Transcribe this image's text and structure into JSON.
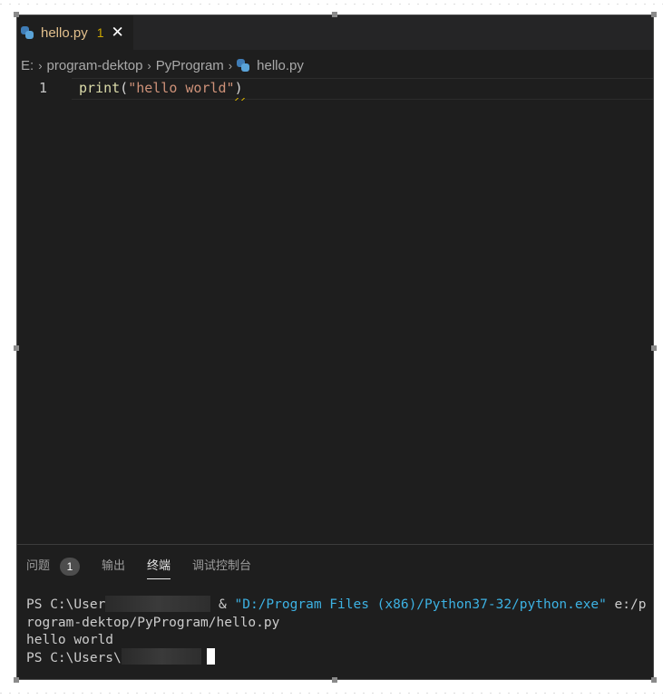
{
  "tab": {
    "title": "hello.py",
    "problems_badge": "1",
    "close_glyph": "✕",
    "icon": "python-file-icon"
  },
  "breadcrumb": {
    "items": [
      "E:",
      "program-dektop",
      "PyProgram",
      "hello.py"
    ],
    "separator": "›"
  },
  "editor": {
    "lines": [
      {
        "number": "1",
        "tokens": {
          "fn": "print",
          "open": "(",
          "str": "\"hello world\"",
          "close": ")"
        }
      }
    ]
  },
  "panel": {
    "tabs": [
      {
        "label": "问题",
        "badge": "1"
      },
      {
        "label": "输出"
      },
      {
        "label": "终端",
        "active": true
      },
      {
        "label": "调试控制台"
      }
    ]
  },
  "terminal": {
    "line1_prompt": "PS C:\\User",
    "line1_amp": "& ",
    "line1_exe": "\"D:/Program Files (x86)/Python37-32/python.exe\"",
    "line1_arg": " e:/p",
    "line2": "rogram-dektop/PyProgram/hello.py",
    "line3": "hello world",
    "line4_prompt": "PS C:\\Users\\"
  },
  "colors": {
    "editor_bg": "#1e1e1e",
    "tab_modified": "#e2c08d",
    "warning": "#cca700",
    "string": "#ce9178",
    "function": "#dcdcaa",
    "terminal_string": "#3db2e3"
  }
}
